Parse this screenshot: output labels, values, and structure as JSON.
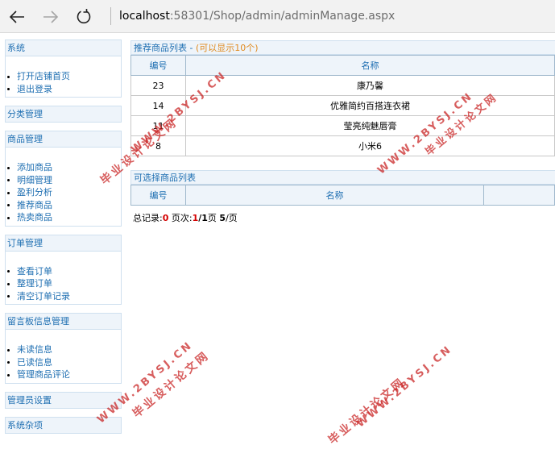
{
  "browser": {
    "url_host": "localhost",
    "url_rest": ":58301/Shop/admin/adminManage.aspx"
  },
  "sidebar": {
    "panels": [
      {
        "title": "系统",
        "items": [
          "打开店铺首页",
          "退出登录"
        ]
      },
      {
        "title": "分类管理",
        "items": []
      },
      {
        "title": "商品管理",
        "items": [
          "添加商品",
          "明细管理",
          "盈利分析",
          "推荐商品",
          "热卖商品"
        ]
      },
      {
        "title": "订单管理",
        "items": [
          "查看订单",
          "整理订单",
          "清空订单记录"
        ]
      },
      {
        "title": "留言板信息管理",
        "items": [
          "未读信息",
          "已读信息",
          "管理商品评论"
        ]
      },
      {
        "title": "管理员设置",
        "items": []
      },
      {
        "title": "系统杂项",
        "items": []
      }
    ]
  },
  "recommended": {
    "title": "推荐商品列表 - ",
    "hint": "(可以显示10个)",
    "columns": [
      "编号",
      "名称"
    ],
    "rows": [
      {
        "id": "23",
        "name": "康乃馨"
      },
      {
        "id": "14",
        "name": "优雅简约百搭连衣裙"
      },
      {
        "id": "11",
        "name": "莹亮纯魅唇膏"
      },
      {
        "id": "8",
        "name": "小米6"
      }
    ]
  },
  "selectable": {
    "title": "可选择商品列表",
    "columns": [
      "编号",
      "名称",
      ""
    ],
    "pager": {
      "total_label": "总记录:",
      "total": "0",
      "page_label": " 页次:",
      "page_current": "1",
      "page_sep": "/",
      "page_total": "1",
      "page_suffix": "页 ",
      "per_page": "5",
      "per_page_suffix": "/页"
    }
  },
  "watermarks": {
    "site": "WWW.2BYSJ.CN",
    "name": "毕业设计论文网"
  },
  "colors": {
    "link": "#1f6fb2",
    "hint": "#e08a1e",
    "pager_red": "#d40000",
    "watermark": "#c81e1e"
  }
}
